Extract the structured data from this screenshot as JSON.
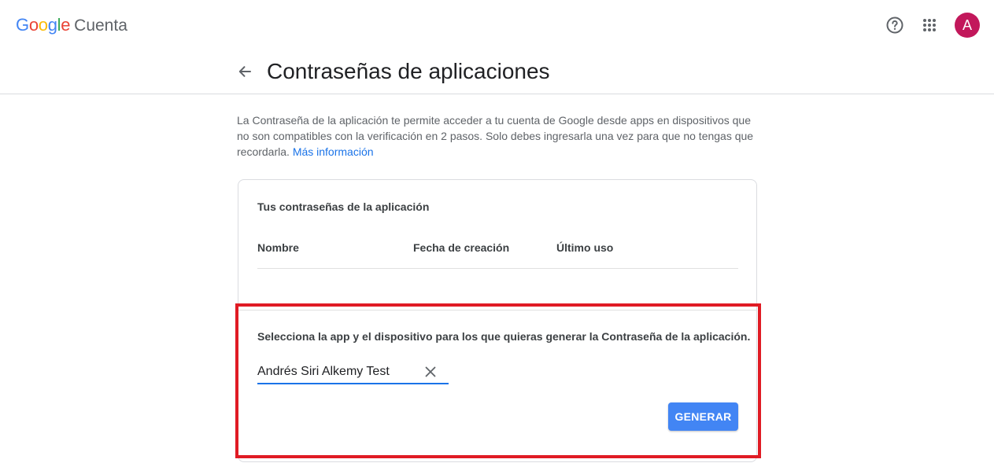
{
  "brand": {
    "logo_letters": [
      "G",
      "o",
      "o",
      "g",
      "l",
      "e"
    ],
    "logo_colors": [
      "#4285F4",
      "#EA4335",
      "#FBBC05",
      "#4285F4",
      "#34A853",
      "#EA4335"
    ],
    "product": "Cuenta"
  },
  "header": {
    "help_icon": "help-circle-icon",
    "apps_icon": "apps-grid-icon",
    "avatar_initial": "A",
    "avatar_color": "#c2185b"
  },
  "page": {
    "back_icon": "arrow-left-icon",
    "title": "Contraseñas de aplicaciones"
  },
  "description": {
    "text": "La Contraseña de la aplicación te permite acceder a tu cuenta de Google desde apps en dispositivos que no son compatibles con la verificación en 2 pasos. Solo debes ingresarla una vez para que no tengas que recordarla. ",
    "link": "Más información"
  },
  "card": {
    "title": "Tus contraseñas de la aplicación",
    "columns": [
      "Nombre",
      "Fecha de creación",
      "Último uso"
    ],
    "generate_label": "Selecciona la app y el dispositivo para los que quieras generar la Contraseña de la aplicación.",
    "input_value": "Andrés Siri Alkemy Test",
    "clear_icon": "close-icon",
    "generate_button": "GENERAR"
  },
  "colors": {
    "accent": "#1a73e8",
    "button": "#4285f4",
    "highlight": "#e01b24"
  }
}
